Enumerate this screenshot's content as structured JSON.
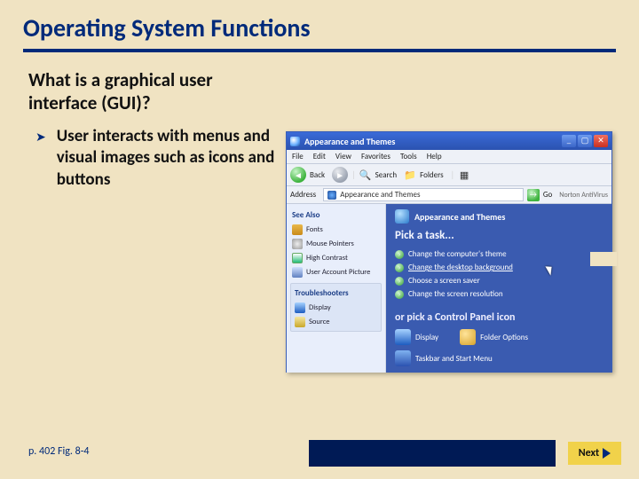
{
  "title": "Operating System Functions",
  "subhead": "What is a graphical user interface (GUI)?",
  "bullet": "User interacts with menus and visual images such as icons and buttons",
  "footer_ref": "p. 402 Fig. 8-4",
  "next_label": "Next",
  "window": {
    "title": "Appearance and Themes",
    "min": "_",
    "max": "▢",
    "close": "✕",
    "menus": [
      "File",
      "Edit",
      "View",
      "Favorites",
      "Tools",
      "Help"
    ],
    "back": "◄",
    "back_label": "Back",
    "forward": "►",
    "search_label": "Search",
    "folders_label": "Folders",
    "address_label": "Address",
    "address_value": "Appearance and Themes",
    "go_label": "Go",
    "norton": "Norton AntiVirus",
    "see_also": "See Also",
    "see_items": [
      "Fonts",
      "Mouse Pointers",
      "High Contrast",
      "User Account Picture"
    ],
    "troubleshooters": "Troubleshooters",
    "trouble_items": [
      "Display",
      "Source"
    ],
    "rp_title": "Appearance and Themes",
    "pick": "Pick a task...",
    "tasks": [
      "Change the computer's theme",
      "Change the desktop background",
      "Choose a screen saver",
      "Change the screen resolution"
    ],
    "or_pick": "or pick a Control Panel icon",
    "cp_items": [
      "Display",
      "Folder Options",
      "Taskbar and Start Menu"
    ]
  }
}
